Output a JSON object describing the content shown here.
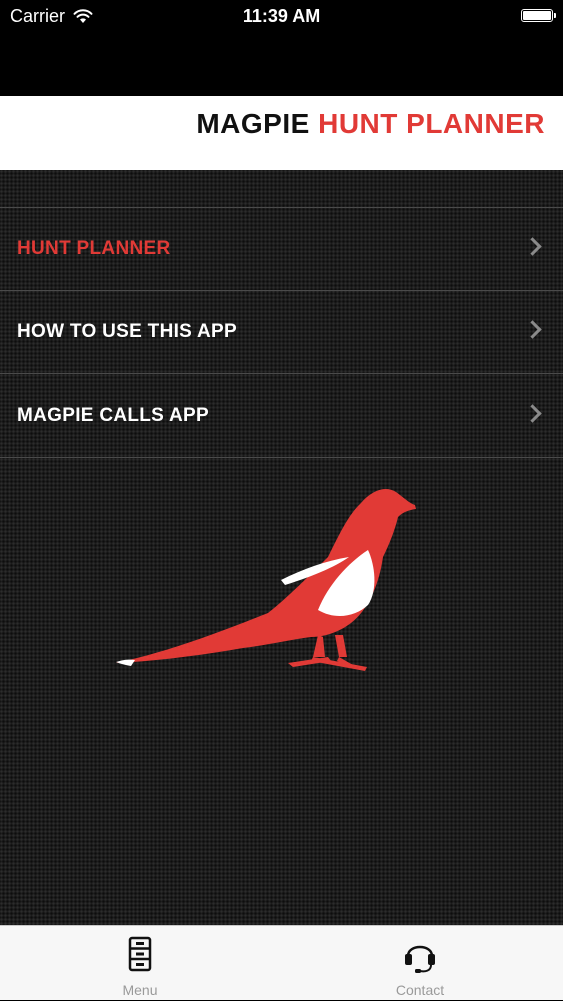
{
  "status_bar": {
    "carrier": "Carrier",
    "time": "11:39 AM",
    "wifi_icon": "wifi-icon",
    "battery_icon": "battery-full-icon"
  },
  "header": {
    "title_part1": "MAGPIE",
    "title_part2": "HUNT PLANNER"
  },
  "menu": {
    "items": [
      {
        "label": "HUNT PLANNER",
        "active": true
      },
      {
        "label": "HOW TO USE THIS APP",
        "active": false
      },
      {
        "label": "MAGPIE CALLS APP",
        "active": false
      }
    ]
  },
  "tab_bar": {
    "tabs": [
      {
        "label": "Menu",
        "icon": "file-cabinet-icon",
        "selected": true
      },
      {
        "label": "Contact",
        "icon": "headset-icon",
        "selected": false
      }
    ]
  },
  "colors": {
    "accent_red": "#e13a36",
    "background": "#1c1c1c",
    "header_bg": "#ffffff",
    "tab_bar_bg": "#f7f7f7"
  }
}
